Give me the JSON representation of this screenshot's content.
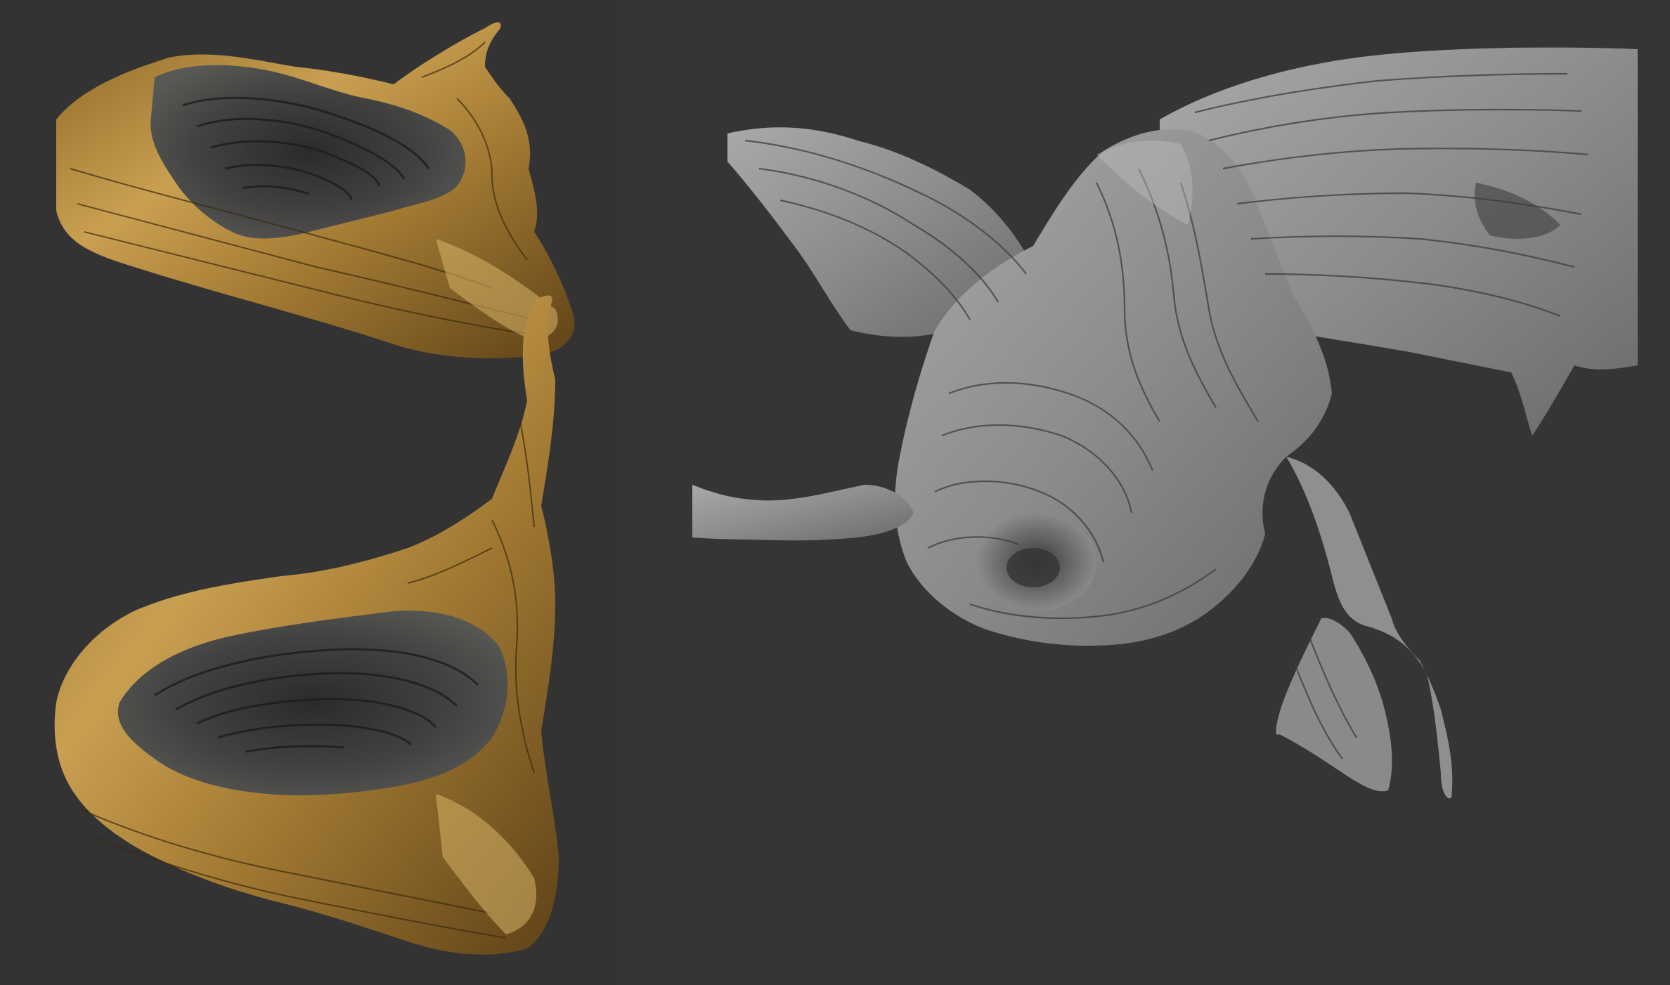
{
  "canvas": {
    "background": "#353535",
    "panel_background": "#333333"
  },
  "views": [
    {
      "name": "textured-render-top",
      "material": "gold-and-charcoal",
      "colors": {
        "gold": "#b48a3c",
        "gold_light": "#e2c27a",
        "gold_dark": "#5d4318",
        "charcoal": "#3c3d3b",
        "charcoal_dark": "#1e1f1e"
      }
    },
    {
      "name": "textured-render-bottom",
      "material": "gold-and-charcoal",
      "colors": {
        "gold": "#b48a3c",
        "gold_light": "#e2c27a",
        "gold_dark": "#5d4318",
        "charcoal": "#3c3d3b",
        "charcoal_dark": "#1e1f1e"
      }
    },
    {
      "name": "clay-sculpt-render",
      "material": "grey-clay",
      "colors": {
        "clay": "#8e8e8e",
        "clay_light": "#b4b4b4",
        "clay_dark": "#4a4a4a"
      }
    }
  ]
}
